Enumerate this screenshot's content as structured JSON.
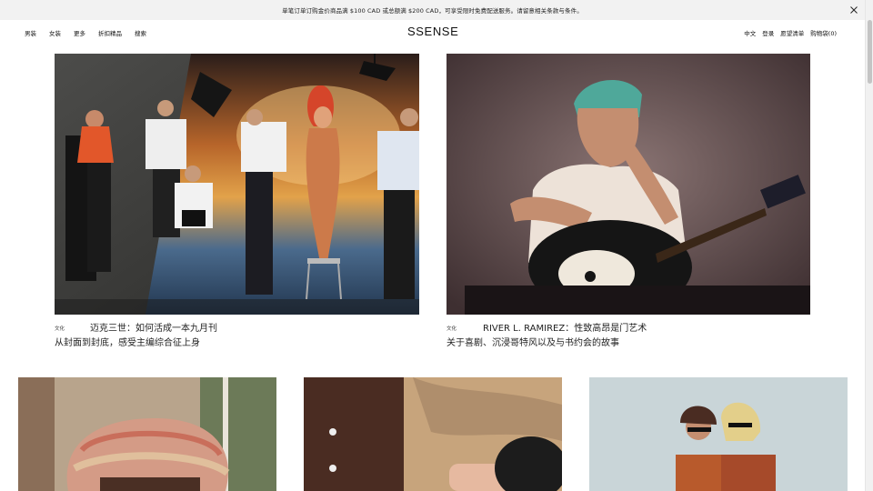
{
  "banner": {
    "text": "单笔订单订购金价商品满 $100 CAD 或总额满 $200 CAD，可享受限时免费配送服务。请留意相关条款与条件。"
  },
  "nav_left": [
    "男装",
    "女装",
    "更多",
    "折扣精品",
    "搜索"
  ],
  "logo": "SSENSE",
  "nav_right": {
    "language": "中文",
    "login": "登录",
    "wishlist": "愿望清单",
    "bag": "购物袋",
    "bag_count": "(0)"
  },
  "features": [
    {
      "category": "文化",
      "title": "迈克三世：如何活成一本九月刊",
      "subtitle": "从封面到封底，感受主编综合征上身"
    },
    {
      "category": "文化",
      "title": "RIVER L. RAMIREZ：性致高昂是门艺术",
      "subtitle": "关于喜剧、沉浸哥特风以及与书约会的故事"
    }
  ],
  "colors": {
    "banner_bg": "#f2f2f2",
    "text": "#111111"
  }
}
